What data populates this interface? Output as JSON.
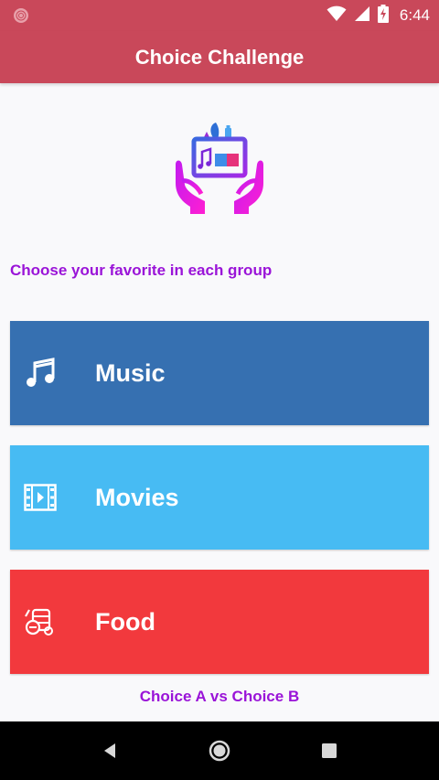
{
  "status_bar": {
    "time": "6:44",
    "icons": [
      "notification-icon",
      "wifi-icon",
      "signal-icon",
      "battery-charging-icon"
    ]
  },
  "app_bar": {
    "title": "Choice Challenge"
  },
  "logo": {
    "icon": "hands-holding-media-icon"
  },
  "subtitle": "Choose your favorite in each group",
  "categories": [
    {
      "label": "Music",
      "icon": "music-note-icon",
      "color": "#3670b1"
    },
    {
      "label": "Movies",
      "icon": "film-icon",
      "color": "#47bbf3"
    },
    {
      "label": "Food",
      "icon": "food-icon",
      "color": "#f2393d"
    }
  ],
  "footer": "Choice A vs Choice B",
  "nav_bar": {
    "buttons": [
      "back-icon",
      "home-icon",
      "recents-icon"
    ]
  },
  "colors": {
    "primary": "#c9485a",
    "accent_text": "#9a14d8"
  }
}
